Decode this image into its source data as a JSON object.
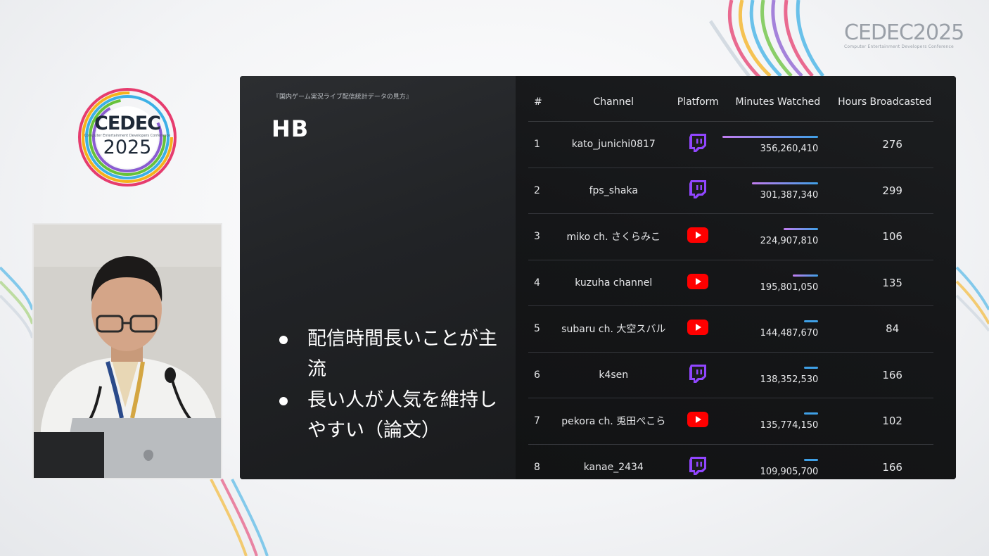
{
  "event": {
    "name": "CEDEC",
    "year": "2025",
    "tagline": "Computer Entertainment Developers Conference"
  },
  "slide": {
    "breadcrumb": "『国内ゲーム実況ライブ配信統計データの見方』",
    "title": "HB",
    "bullets": [
      "配信時間長いことが主流",
      "長い人が人気を維持しやすい（論文）"
    ]
  },
  "table": {
    "headers": [
      "#",
      "Channel",
      "Platform",
      "Minutes Watched",
      "Hours Broadcasted"
    ],
    "max_minutes": 356260410,
    "rows": [
      {
        "rank": "1",
        "channel": "kato_junichi0817",
        "platform": "twitch-icon",
        "minutes": 356260410,
        "minutes_label": "356,260,410",
        "hours": "276"
      },
      {
        "rank": "2",
        "channel": "fps_shaka",
        "platform": "twitch-icon",
        "minutes": 301387340,
        "minutes_label": "301,387,340",
        "hours": "299"
      },
      {
        "rank": "3",
        "channel": "miko ch. さくらみこ",
        "platform": "youtube-icon",
        "minutes": 224907810,
        "minutes_label": "224,907,810",
        "hours": "106"
      },
      {
        "rank": "4",
        "channel": "kuzuha channel",
        "platform": "youtube-icon",
        "minutes": 195801050,
        "minutes_label": "195,801,050",
        "hours": "135"
      },
      {
        "rank": "5",
        "channel": "subaru ch. 大空スバル",
        "platform": "youtube-icon",
        "minutes": 144487670,
        "minutes_label": "144,487,670",
        "hours": "84"
      },
      {
        "rank": "6",
        "channel": "k4sen",
        "platform": "twitch-icon",
        "minutes": 138352530,
        "minutes_label": "138,352,530",
        "hours": "166"
      },
      {
        "rank": "7",
        "channel": "pekora ch. 兎田ぺこら",
        "platform": "youtube-icon",
        "minutes": 135774150,
        "minutes_label": "135,774,150",
        "hours": "102"
      },
      {
        "rank": "8",
        "channel": "kanae_2434",
        "platform": "twitch-icon",
        "minutes": 109905700,
        "minutes_label": "109,905,700",
        "hours": "166"
      }
    ]
  },
  "colors": {
    "twitch": "#9146ff",
    "youtube": "#ff0000",
    "bar_start": "#c27df0",
    "bar_end": "#3fa0e6"
  }
}
